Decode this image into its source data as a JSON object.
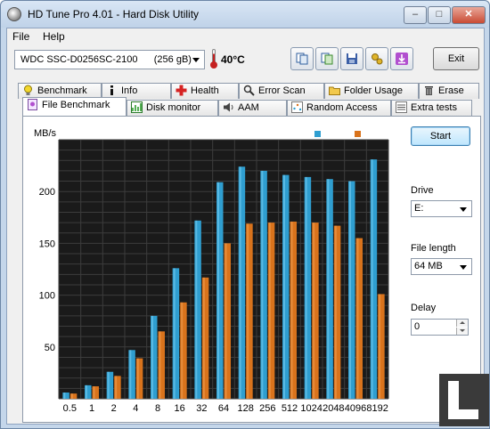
{
  "window": {
    "title": "HD Tune Pro 4.01 - Hard Disk Utility",
    "minimize_glyph": "–",
    "maximize_glyph": "□",
    "close_glyph": "✕"
  },
  "menu": {
    "file": "File",
    "help": "Help"
  },
  "toolbar": {
    "drive": "WDC SSC-D0256SC-2100      (256 gB)",
    "temperature": "40°C",
    "exit_label": "Exit",
    "buttons": [
      "copy-info-icon",
      "copy-screenshot-icon",
      "save-icon",
      "options-icon",
      "download-icon"
    ]
  },
  "tabs_top": [
    {
      "label": "Benchmark",
      "icon": "lightbulb-icon"
    },
    {
      "label": "Info",
      "icon": "info-icon"
    },
    {
      "label": "Health",
      "icon": "health-cross-icon"
    },
    {
      "label": "Error Scan",
      "icon": "magnifier-icon"
    },
    {
      "label": "Folder Usage",
      "icon": "folder-icon"
    },
    {
      "label": "Erase",
      "icon": "trash-icon"
    }
  ],
  "tabs_bottom": [
    {
      "label": "File Benchmark",
      "icon": "file-benchmark-icon",
      "active": true
    },
    {
      "label": "Disk monitor",
      "icon": "disk-monitor-icon"
    },
    {
      "label": "AAM",
      "icon": "speaker-icon"
    },
    {
      "label": "Random Access",
      "icon": "random-access-icon"
    },
    {
      "label": "Extra tests",
      "icon": "extra-tests-icon"
    }
  ],
  "side_panel": {
    "start_label": "Start",
    "drive_label": "Drive",
    "drive_value": "E:",
    "file_length_label": "File length",
    "file_length_value": "64 MB",
    "delay_label": "Delay",
    "delay_value": "0"
  },
  "colors": {
    "read": "#2f9ed0",
    "write": "#d9731c",
    "plot_bg": "#1a1a1a",
    "grid": "#3c3c3c"
  },
  "chart_data": {
    "type": "bar",
    "title": "",
    "xlabel": "",
    "ylabel": "MB/s",
    "ylim": [
      0,
      250
    ],
    "yticks": [
      50,
      100,
      150,
      200
    ],
    "legend_placement": "top-right",
    "grid": true,
    "categories": [
      "0.5",
      "1",
      "2",
      "4",
      "8",
      "16",
      "32",
      "64",
      "128",
      "256",
      "512",
      "1024",
      "2048",
      "4096",
      "8192"
    ],
    "series": [
      {
        "name": "read",
        "values": [
          6,
          13,
          26,
          47,
          80,
          126,
          172,
          209,
          224,
          220,
          216,
          214,
          212,
          210,
          231
        ]
      },
      {
        "name": "write",
        "values": [
          5,
          12,
          22,
          39,
          65,
          93,
          117,
          150,
          169,
          170,
          171,
          170,
          167,
          155,
          101
        ]
      }
    ]
  }
}
